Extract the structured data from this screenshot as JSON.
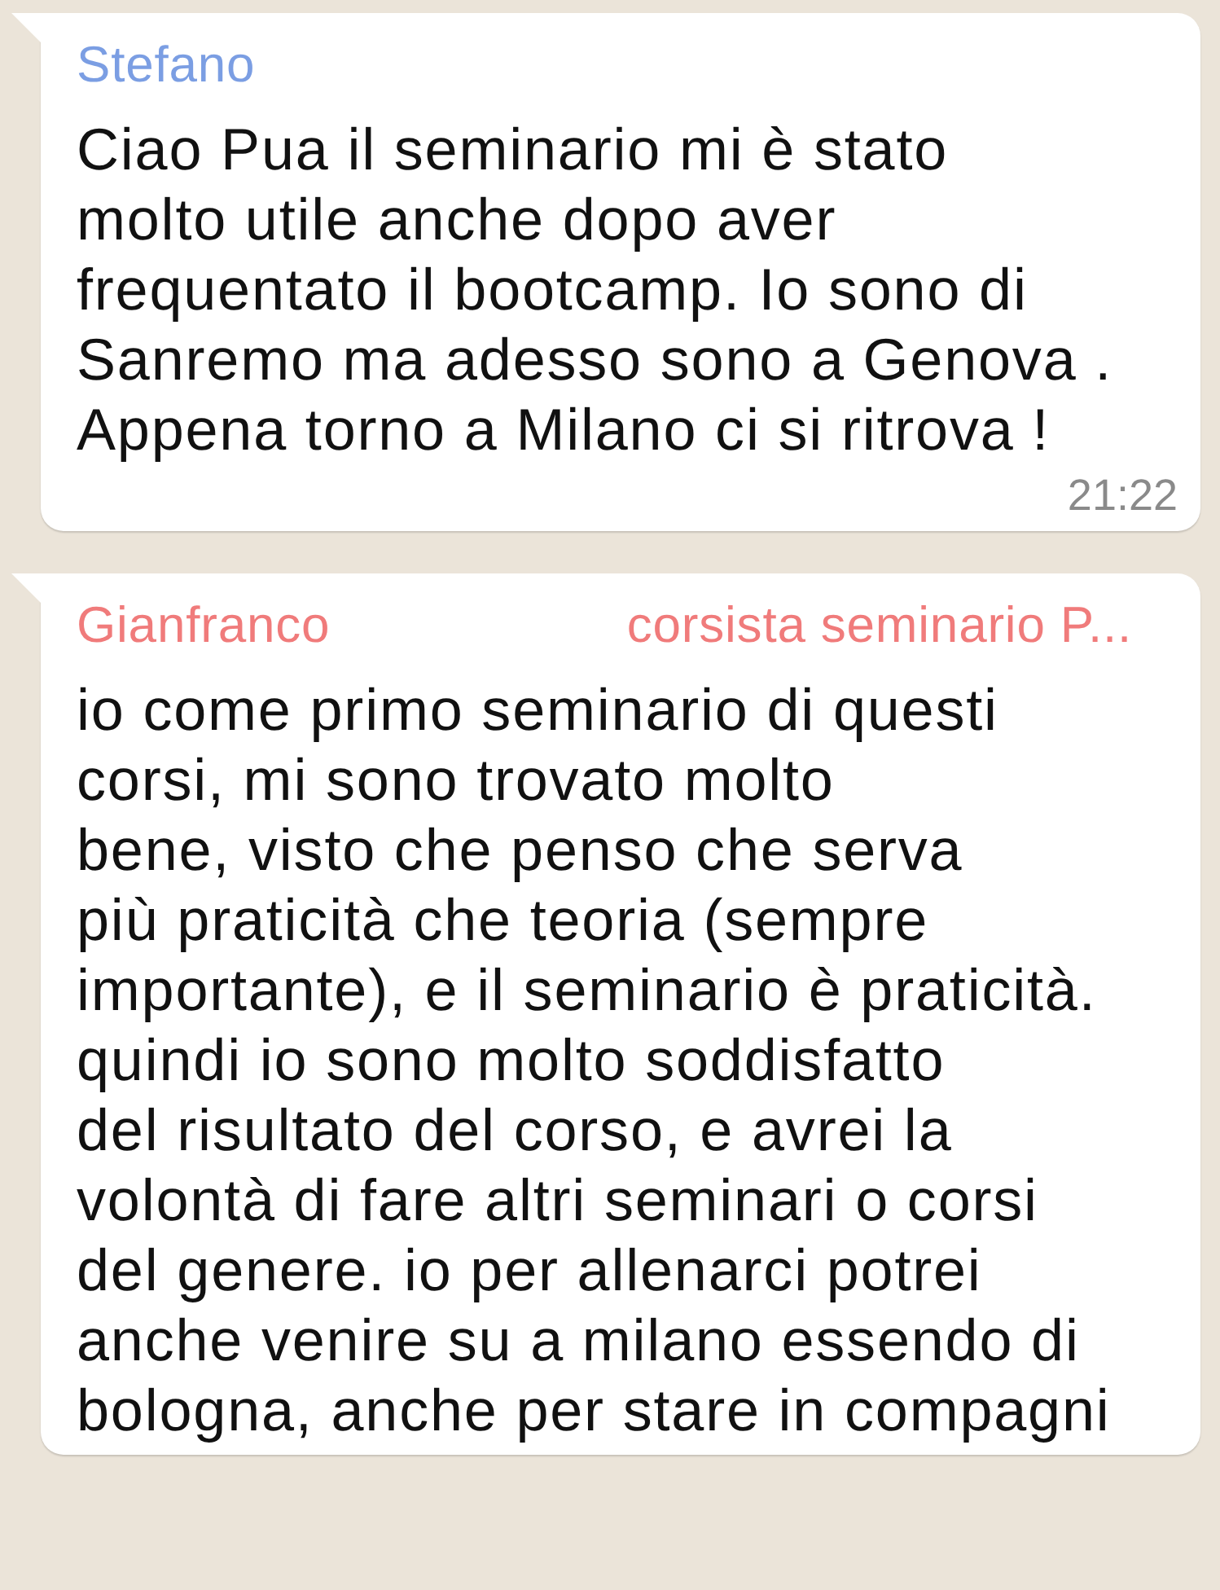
{
  "messages": [
    {
      "sender": "Stefano",
      "color": "#7b9ee3",
      "body": "Ciao Pua il seminario mi è stato\nmolto utile anche dopo aver\nfrequentato il bootcamp. Io sono di\nSanremo ma adesso sono a Genova .\nAppena torno a Milano ci si ritrova !",
      "time": "21:22"
    },
    {
      "sender": "Gianfranco",
      "color": "#f07b7b",
      "sender_note": "corsista seminario P...",
      "body": "io come primo seminario di questi\ncorsi, mi sono trovato molto\nbene, visto che penso che serva\npiù praticità che teoria (sempre\nimportante), e il seminario è praticità.\nquindi io sono molto soddisfatto\ndel risultato del corso, e avrei la\nvolontà di fare altri seminari o corsi\ndel genere. io per allenarci potrei\nanche venire su a milano essendo di\nbologna, anche per stare in compagni"
    }
  ]
}
